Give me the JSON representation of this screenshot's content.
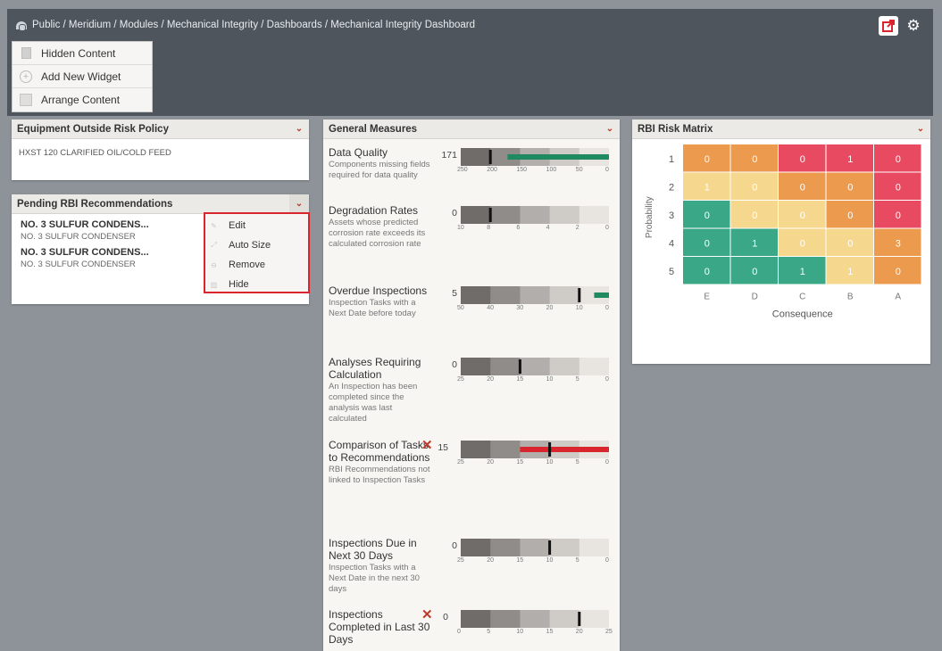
{
  "breadcrumb": "Public / Meridium / Modules / Mechanical Integrity / Dashboards / Mechanical Integrity Dashboard",
  "colors": {
    "green": "#3aa787",
    "yellow": "#f6d78e",
    "orange": "#eb9a4e",
    "red": "#e84b61",
    "bar_green": "#1f8a5f",
    "bar_red": "#d9252e"
  },
  "toolbar": {
    "export_icon": "export-icon",
    "settings_icon": "gear-icon"
  },
  "content_menu": {
    "hidden_content": "Hidden Content",
    "add_new_widget": "Add New Widget",
    "arrange_content": "Arrange Content"
  },
  "equipment_widget": {
    "title": "Equipment Outside Risk Policy",
    "rows": [
      "HXST 120 CLARIFIED OIL/COLD FEED"
    ]
  },
  "pending_widget": {
    "title": "Pending RBI Recommendations",
    "items": [
      {
        "title": "NO. 3 SULFUR CONDENS...",
        "subtitle": "NO. 3 SULFUR CONDENSER"
      },
      {
        "title": "NO. 3 SULFUR CONDENS...",
        "subtitle": "NO. 3 SULFUR CONDENSER"
      }
    ]
  },
  "context_menu": {
    "edit": "Edit",
    "auto_size": "Auto Size",
    "remove": "Remove",
    "hide": "Hide"
  },
  "general_measures": {
    "title": "General Measures",
    "measures": [
      {
        "title": "Data Quality",
        "description": "Components missing fields required for data quality",
        "value": "171",
        "value_num": 171,
        "marker": 200,
        "scale_min": 0,
        "scale_max": 250,
        "reversed": true,
        "ticks": [
          "250",
          "200",
          "150",
          "100",
          "50",
          "0"
        ],
        "bad": false
      },
      {
        "title": "Degradation Rates",
        "description": "Assets whose predicted corrosion rate exceeds its calculated corrosion rate",
        "value": "0",
        "value_num": 0,
        "marker": 8,
        "scale_min": 0,
        "scale_max": 10,
        "reversed": true,
        "ticks": [
          "10",
          "8",
          "6",
          "4",
          "2",
          "0"
        ],
        "bad": false
      },
      {
        "title": "Overdue Inspections",
        "description": "Inspection Tasks with a Next Date before today",
        "value": "5",
        "value_num": 5,
        "marker": 10,
        "scale_min": 0,
        "scale_max": 50,
        "reversed": true,
        "ticks": [
          "50",
          "40",
          "30",
          "20",
          "10",
          "0"
        ],
        "bad": false
      },
      {
        "title": "Analyses Requiring Calculation",
        "description": "An Inspection has been completed since the analysis was last calculated",
        "value": "0",
        "value_num": 0,
        "marker": 15,
        "scale_min": 0,
        "scale_max": 25,
        "reversed": true,
        "ticks": [
          "25",
          "20",
          "15",
          "10",
          "5",
          "0"
        ],
        "bad": false
      },
      {
        "title": "Comparison of Tasks to Recommendations",
        "description": "RBI Recommendations not linked to Inspection Tasks",
        "value": "15",
        "value_num": 15,
        "marker": 10,
        "scale_min": 0,
        "scale_max": 25,
        "reversed": true,
        "ticks": [
          "25",
          "20",
          "15",
          "10",
          "5",
          "0"
        ],
        "bad": true
      },
      {
        "title": "Inspections Due in Next 30 Days",
        "description": "Inspection Tasks with a Next Date in the next 30 days",
        "value": "0",
        "value_num": 0,
        "marker": 10,
        "scale_min": 0,
        "scale_max": 25,
        "reversed": true,
        "ticks": [
          "25",
          "20",
          "15",
          "10",
          "5",
          "0"
        ],
        "bad": false
      },
      {
        "title": "Inspections Completed in Last 30 Days",
        "description": "",
        "value": "0",
        "value_num": 0,
        "marker": 20,
        "scale_min": 0,
        "scale_max": 25,
        "reversed": false,
        "ticks": [
          "0",
          "5",
          "10",
          "15",
          "20",
          "25"
        ],
        "bad": true
      }
    ]
  },
  "chart_data": {
    "type": "heatmap",
    "title": "RBI Risk Matrix",
    "xlabel": "Consequence",
    "ylabel": "Probability",
    "x": [
      "E",
      "D",
      "C",
      "B",
      "A"
    ],
    "y": [
      "1",
      "2",
      "3",
      "4",
      "5"
    ],
    "values": [
      [
        0,
        0,
        0,
        1,
        0
      ],
      [
        1,
        0,
        0,
        0,
        0
      ],
      [
        0,
        0,
        0,
        0,
        0
      ],
      [
        0,
        1,
        0,
        0,
        3
      ],
      [
        0,
        0,
        1,
        1,
        0
      ]
    ],
    "cell_colors": [
      [
        "orange",
        "orange",
        "red",
        "red",
        "red"
      ],
      [
        "yellow",
        "yellow",
        "orange",
        "orange",
        "red"
      ],
      [
        "green",
        "yellow",
        "yellow",
        "orange",
        "red"
      ],
      [
        "green",
        "green",
        "yellow",
        "yellow",
        "orange"
      ],
      [
        "green",
        "green",
        "green",
        "yellow",
        "orange"
      ]
    ]
  }
}
